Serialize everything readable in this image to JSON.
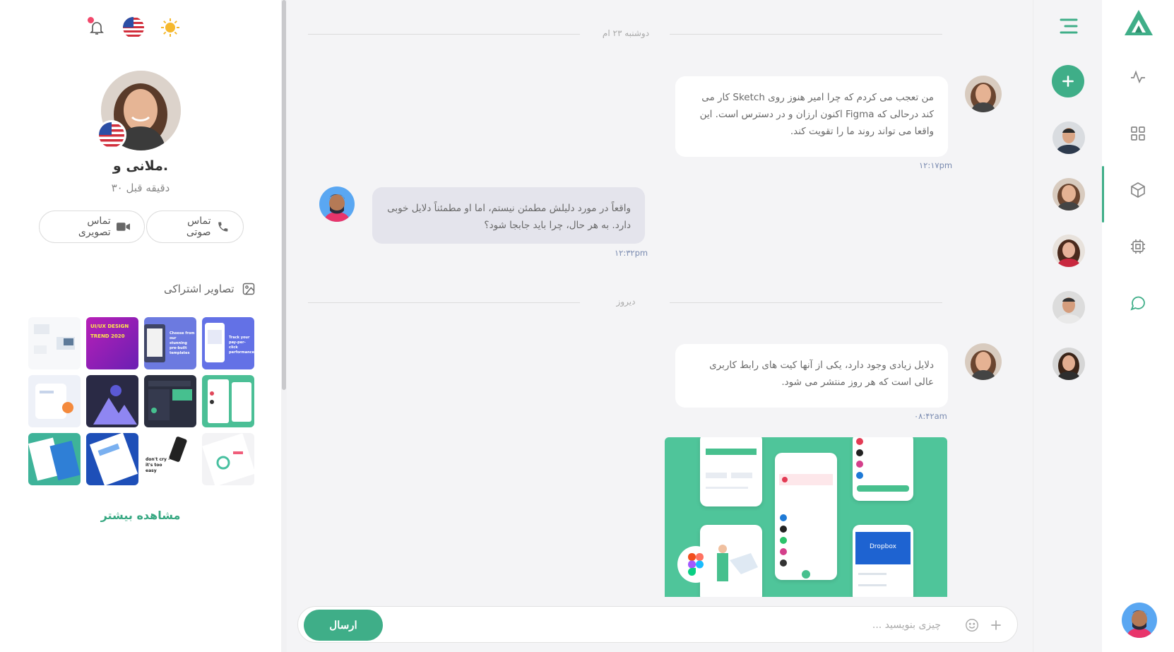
{
  "profile": {
    "name": "ملانی و.",
    "status": "۳۰ دقیقه قبل",
    "video_call_label": "تماس تصویری",
    "voice_call_label": "تماس صوتی",
    "shared_images_title": "تصاویر اشتراکی",
    "see_more_label": "مشاهده بیشتر",
    "shared_thumbs": [
      {
        "label": ""
      },
      {
        "label": "UI/UX DESIGN TREND 2020"
      },
      {
        "label": "Choose from our stunning pre-built templates"
      },
      {
        "label": "Track your pay-per-click performance"
      },
      {
        "label": ""
      },
      {
        "label": ""
      },
      {
        "label": ""
      },
      {
        "label": ""
      },
      {
        "label": ""
      },
      {
        "label": ""
      },
      {
        "label": "don't cry - it's too easy"
      },
      {
        "label": ""
      }
    ]
  },
  "chat": {
    "date_separators": [
      "دوشنبه ۲۳ ام",
      "دیروز"
    ],
    "messages": [
      {
        "direction": "in",
        "text": "من تعجب می کردم که چرا امیر هنوز روی Sketch کار می کند درحالی که Figma اکنون ارزان و در دسترس است. این واقعا می تواند روند ما را تقویت کند.",
        "time": "۱۲:۱۷pm"
      },
      {
        "direction": "out",
        "text": "واقعاً در مورد دلیلش مطمئن نیستم، اما او مطمئناً دلایل خوبی دارد. به هر حال، چرا باید جابجا شود؟",
        "time": "۱۲:۳۲pm"
      },
      {
        "direction": "in",
        "text": "دلایل زیادی وجود دارد، یکی از آنها کیت های رابط کاربری عالی است که هر روز منتشر می شود.",
        "time": "۰۸:۴۲am"
      }
    ],
    "image_message": {
      "dropbox_label": "Dropbox"
    },
    "composer": {
      "placeholder": "چیزی بنویسید ...",
      "send_label": "ارسال"
    }
  },
  "colors": {
    "accent": "#3fae88",
    "bubble_out": "#e4e4ec",
    "time_text": "#7a8bb0",
    "notif_dot": "#f2486b"
  },
  "icons": {
    "notification": "bell-icon",
    "language": "us-flag-icon",
    "theme": "sun-icon",
    "menu": "menu-icon",
    "add": "plus-icon"
  },
  "nav": {
    "active_item": "cube"
  }
}
